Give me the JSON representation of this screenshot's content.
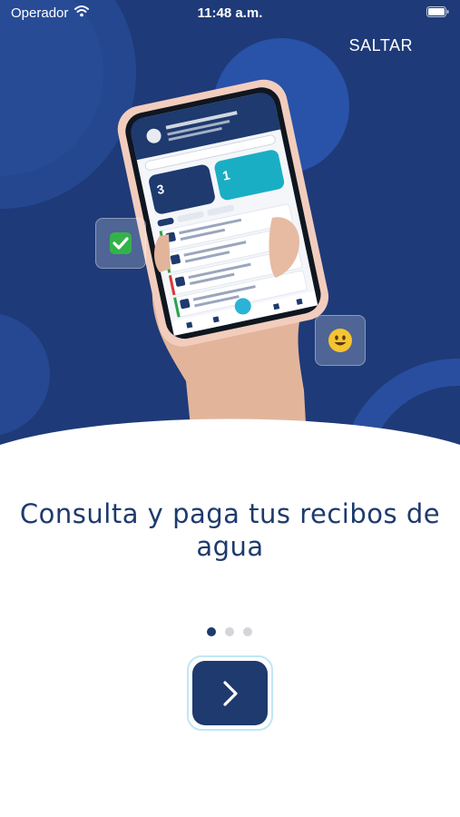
{
  "status_bar": {
    "carrier": "Operador",
    "time": "11:48 a.m.",
    "icons": [
      "wifi-icon",
      "battery-icon"
    ]
  },
  "header": {
    "skip_label": "SALTAR"
  },
  "illustration": {
    "description_icons": [
      "check-badge-icon",
      "smiley-icon"
    ],
    "phone_screen": {
      "counters": [
        "3",
        "1"
      ]
    }
  },
  "content": {
    "title": "Consulta y paga tus recibos de agua"
  },
  "pager": {
    "total": 3,
    "active_index": 0
  },
  "next_button": {
    "icon": "chevron-right-icon"
  },
  "colors": {
    "hero_bg": "#1e3a78",
    "primary": "#1e3a6e",
    "dot_inactive": "#d3d5da",
    "accent": "#2bb3d6",
    "ring": "#bfe7f6"
  }
}
